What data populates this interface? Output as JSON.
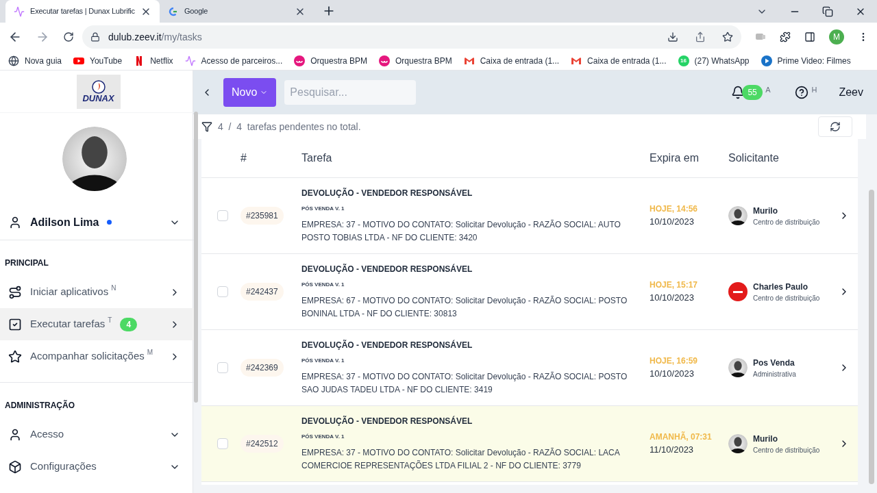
{
  "browser": {
    "tabs": [
      {
        "title": "Executar tarefas | Dunax Lubrific",
        "selected": true,
        "kind": "wave"
      },
      {
        "title": "Google",
        "selected": false,
        "kind": "google"
      }
    ],
    "url_host": "dulub.zeev.it",
    "url_path": "/my/tasks",
    "profile": "M",
    "bookmarks": [
      {
        "label": "Nova guia",
        "kind": "globe"
      },
      {
        "label": "YouTube",
        "kind": "youtube"
      },
      {
        "label": "Netflix",
        "kind": "netflix"
      },
      {
        "label": "Acesso de parceiros...",
        "kind": "wave"
      },
      {
        "label": "Orquestra BPM",
        "kind": "orquestra"
      },
      {
        "label": "Orquestra BPM",
        "kind": "orquestra"
      },
      {
        "label": "Caixa de entrada (1...",
        "kind": "gmail"
      },
      {
        "label": "Caixa de entrada (1...",
        "kind": "gmail"
      },
      {
        "label": "(27) WhatsApp",
        "kind": "whatsapp",
        "badge": "16"
      },
      {
        "label": "Prime Video: Filmes",
        "kind": "prime"
      }
    ]
  },
  "sidebar": {
    "logo": "DUNAX",
    "user": {
      "name": "Adilson Lima",
      "online": true
    },
    "sections": [
      {
        "title": "PRINCIPAL",
        "items": [
          {
            "label": "Iniciar aplicativos",
            "shortcut": "N",
            "kind": "route",
            "selected": false
          },
          {
            "label": "Executar tarefas",
            "shortcut": "T",
            "count": "4",
            "kind": "check",
            "selected": true
          },
          {
            "label": "Acompanhar solicitações",
            "shortcut": "M",
            "kind": "star",
            "selected": false
          }
        ]
      },
      {
        "title": "ADMINISTRAÇÃO",
        "items": [
          {
            "label": "Acesso",
            "kind": "user",
            "selected": false
          },
          {
            "label": "Configurações",
            "kind": "box",
            "selected": false
          }
        ]
      }
    ]
  },
  "header": {
    "new_button": "Novo",
    "search": {
      "placeholder": "Pesquisar..."
    },
    "notifications": "55",
    "notifications_shortcut": "A",
    "help_shortcut": "H",
    "brand": "Zeev"
  },
  "summary": "4  /  4  tarefas pendentes no total.",
  "table": {
    "columns": [
      "#",
      "Tarefa",
      "Expira em",
      "Solicitante"
    ],
    "rows": [
      {
        "checked": false,
        "highlighted": false,
        "id": "#235981",
        "title": "DEVOLUÇÃO - VENDEDOR RESPONSÁVEL",
        "process": "PÓS VENDA V. 1",
        "description": "EMPRESA: 37 - MOTIVO DO CONTATO: Solicitar Devolução - RAZÃO SOCIAL: AUTO POSTO TOBIAS LTDA - NF DO CLIENTE: 3420",
        "due": "HOJE, 14:56",
        "date": "10/10/2023",
        "requester": "Murilo",
        "department": "Centro de distribuição",
        "kind": "person"
      },
      {
        "checked": false,
        "highlighted": false,
        "id": "#242437",
        "title": "DEVOLUÇÃO - VENDEDOR RESPONSÁVEL",
        "process": "PÓS VENDA V. 1",
        "description": "EMPRESA: 67 - MOTIVO DO CONTATO: Solicitar Devolução - RAZÃO SOCIAL: POSTO BONINAL LTDA - NF DO CLIENTE: 30813",
        "due": "HOJE, 15:17",
        "date": "10/10/2023",
        "requester": "Charles Paulo",
        "department": "Centro de distribuição",
        "kind": "company"
      },
      {
        "checked": false,
        "highlighted": false,
        "id": "#242369",
        "title": "DEVOLUÇÃO - VENDEDOR RESPONSÁVEL",
        "process": "PÓS VENDA V. 1",
        "description": "EMPRESA: 37 - MOTIVO DO CONTATO: Solicitar Devolução - RAZÃO SOCIAL: POSTO SAO JUDAS TADEU LTDA - NF DO CLIENTE: 3419",
        "due": "HOJE, 16:59",
        "date": "10/10/2023",
        "requester": "Pos Venda",
        "department": "Administrativa",
        "kind": "person"
      },
      {
        "checked": false,
        "highlighted": true,
        "id": "#242512",
        "title": "DEVOLUÇÃO - VENDEDOR RESPONSÁVEL",
        "process": "PÓS VENDA V. 1",
        "description": "EMPRESA: 37 - MOTIVO DO CONTATO: Solicitar Devolução - RAZÃO SOCIAL: LACA COMERCIOE REPRESENTAÇÕES LTDA FILIAL 2 - NF DO CLIENTE: 3779",
        "due": "AMANHÃ, 07:31",
        "date": "11/10/2023",
        "requester": "Murilo",
        "department": "Centro de distribuição",
        "kind": "person"
      }
    ]
  }
}
